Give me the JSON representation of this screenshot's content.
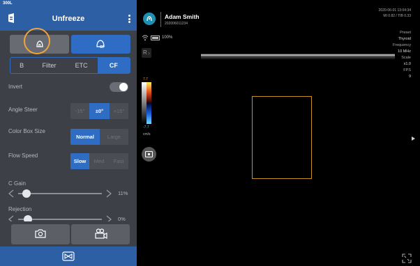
{
  "statusbar": {
    "label": "300L"
  },
  "header": {
    "title": "Unfreeze"
  },
  "mode_buttons": [
    {
      "icon": "b-mode-probe-icon",
      "active": false
    },
    {
      "icon": "cf-mode-probe-icon",
      "active": true,
      "badge": "CF"
    }
  ],
  "tabs": [
    {
      "label": "B",
      "active": false
    },
    {
      "label": "Filter",
      "active": false
    },
    {
      "label": "ETC",
      "active": false
    },
    {
      "label": "CF",
      "active": true
    }
  ],
  "settings": {
    "invert": {
      "label": "Invert",
      "on": false
    },
    "angle_steer": {
      "label": "Angle Steer",
      "options": [
        "-15°",
        "±0°",
        "+15°"
      ],
      "selected": "±0°"
    },
    "color_box_size": {
      "label": "Color Box Size",
      "options": [
        "Normal",
        "Large"
      ],
      "selected": "Normal"
    },
    "flow_speed": {
      "label": "Flow Speed",
      "options": [
        "Slow",
        "Med",
        "Fast"
      ],
      "selected": "Slow"
    },
    "c_gain": {
      "label": "C Gain",
      "value_text": "11%",
      "level": 0.11
    },
    "rejection": {
      "label": "Rejection",
      "value_text": "0%",
      "level": 0.0
    }
  },
  "actions": [
    {
      "icon": "camera-icon"
    },
    {
      "icon": "video-camera-icon"
    }
  ],
  "freeze_bar": {
    "icon": "freeze-toggle-icon"
  },
  "patient": {
    "name": "Adam Smith",
    "id": "202006011234"
  },
  "datetime": {
    "date_time": "2020-06-01 13:04:34",
    "mi_ti": "MI 0.82 / TIB 0.33"
  },
  "device": {
    "battery_pct": "100%",
    "r_label": "R"
  },
  "scan_params": [
    {
      "label": "Preset",
      "value": "Thyroid"
    },
    {
      "label": "Frequency",
      "value": "10 MHz"
    },
    {
      "label": "Scale",
      "value": "x1.0"
    },
    {
      "label": "FPS",
      "value": "9"
    }
  ],
  "color_scale": {
    "top": "7.7",
    "bottom": "-7.7",
    "unit": "cm/s"
  },
  "colors": {
    "panel_bg": "#3d4046",
    "accent_blue": "#2f6cc4",
    "header_blue": "#2d5fa5",
    "roi_outline": "#c9921e",
    "highlight_ring": "#f0a43a"
  }
}
